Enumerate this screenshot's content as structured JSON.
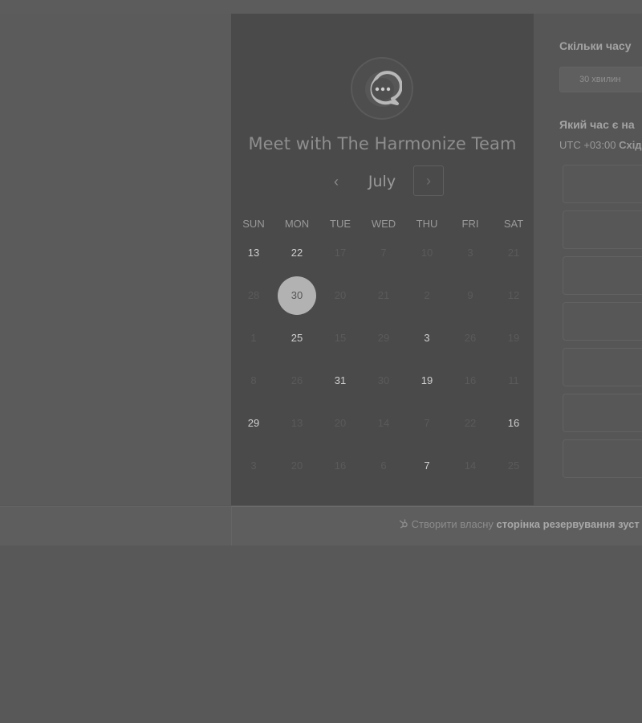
{
  "calendar": {
    "title": "Meet with The Harmonize Team",
    "month": "July",
    "prev_icon": "‹",
    "next_icon": "›",
    "weekdays": [
      "SUN",
      "MON",
      "TUE",
      "WED",
      "THU",
      "FRI",
      "SAT"
    ],
    "weeks": [
      [
        {
          "d": "13",
          "a": true
        },
        {
          "d": "22",
          "a": true
        },
        {
          "d": "17",
          "a": false
        },
        {
          "d": "7",
          "a": false
        },
        {
          "d": "10",
          "a": false
        },
        {
          "d": "3",
          "a": false
        },
        {
          "d": "21",
          "a": false
        }
      ],
      [
        {
          "d": "28",
          "a": false
        },
        {
          "d": "30",
          "a": true,
          "sel": true
        },
        {
          "d": "20",
          "a": false
        },
        {
          "d": "21",
          "a": false
        },
        {
          "d": "2",
          "a": false
        },
        {
          "d": "9",
          "a": false
        },
        {
          "d": "12",
          "a": false
        }
      ],
      [
        {
          "d": "1",
          "a": false
        },
        {
          "d": "25",
          "a": true
        },
        {
          "d": "15",
          "a": false
        },
        {
          "d": "29",
          "a": false
        },
        {
          "d": "3",
          "a": true
        },
        {
          "d": "26",
          "a": false
        },
        {
          "d": "19",
          "a": false
        }
      ],
      [
        {
          "d": "8",
          "a": false
        },
        {
          "d": "26",
          "a": false
        },
        {
          "d": "31",
          "a": true
        },
        {
          "d": "30",
          "a": false
        },
        {
          "d": "19",
          "a": true
        },
        {
          "d": "16",
          "a": false
        },
        {
          "d": "11",
          "a": false
        }
      ],
      [
        {
          "d": "29",
          "a": true
        },
        {
          "d": "13",
          "a": false
        },
        {
          "d": "20",
          "a": false
        },
        {
          "d": "14",
          "a": false
        },
        {
          "d": "7",
          "a": false
        },
        {
          "d": "22",
          "a": false
        },
        {
          "d": "16",
          "a": true
        }
      ],
      [
        {
          "d": "3",
          "a": false
        },
        {
          "d": "20",
          "a": false
        },
        {
          "d": "16",
          "a": false
        },
        {
          "d": "6",
          "a": false
        },
        {
          "d": "7",
          "a": true
        },
        {
          "d": "14",
          "a": false
        },
        {
          "d": "25",
          "a": false
        }
      ]
    ]
  },
  "booking": {
    "duration_question": "Скільки часу",
    "duration_option": "30 хвилин",
    "time_question": "Який час є на",
    "timezone_prefix": "UTC +03:00",
    "timezone_name": "Схід",
    "slots": [
      "",
      "",
      "",
      "",
      "",
      "",
      ""
    ]
  },
  "footer": {
    "prefix": "Створити власну",
    "link": "сторінка резервування зуст"
  },
  "colors": {
    "overlay": "#585858",
    "panel": "#4a4a4a",
    "selected_day": "#b2b2b2"
  },
  "icons": {
    "logo": "chat-bubble-icon",
    "footer": "hubspot-sprocket-icon"
  }
}
